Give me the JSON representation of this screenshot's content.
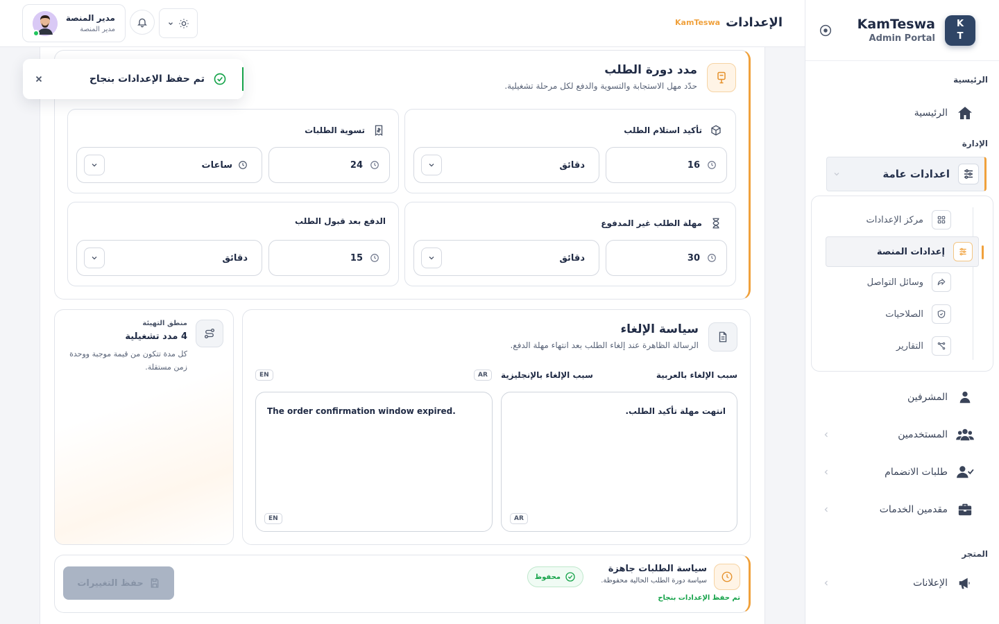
{
  "brand": {
    "initials_top": "K",
    "initials_bottom": "T",
    "name": "KamTeswa",
    "sub": "Admin Portal"
  },
  "sidebar": {
    "section_main": "الرئيسية",
    "home": "الرئيسية",
    "section_admin": "الإدارة",
    "general_settings": "اعدادات عامة",
    "submenu": [
      "مركز الإعدادات",
      "إعدادات المنصة",
      "وسائل التواصل",
      "الصلاحيات",
      "التقارير"
    ],
    "supervisors": "المشرفين",
    "users": "المستخدمين",
    "join_requests": "طلبات الانضمام",
    "providers": "مقدمين الخدمات",
    "section_store": "المتجر",
    "ads": "الإعلانات"
  },
  "topbar": {
    "title": "الإعدادات",
    "brand_badge": "KamTeswa"
  },
  "user": {
    "name": "مدير المنصة",
    "role": "مدير المنصة"
  },
  "lifecycle": {
    "title": "مدد دورة الطلب",
    "subtitle": "حدّد مهل الاستجابة والتسوية والدفع لكل مرحلة تشغيلية.",
    "confirm": {
      "label": "تأكيد استلام الطلب",
      "value": "16",
      "unit": "دقائق"
    },
    "settle": {
      "label": "تسوية الطلبات",
      "value": "24",
      "unit": "ساعات"
    },
    "unpaid": {
      "label": "مهلة الطلب غير المدفوع",
      "value": "30",
      "unit": "دقائق"
    },
    "payment": {
      "label": "الدفع بعد قبول الطلب",
      "value": "15",
      "unit": "دقائق"
    }
  },
  "cancel": {
    "title": "سياسة الإلغاء",
    "subtitle": "الرسالة الظاهرة عند إلغاء الطلب بعد انتهاء مهلة الدفع.",
    "ar_label": "سبب الإلغاء بالعربية",
    "en_label": "سبب الإلغاء بالإنجليزية",
    "ar_tag": "AR",
    "en_tag": "EN",
    "ar_value": "انتهت مهلة تأكيد الطلب.",
    "en_value": "The order confirmation window expired."
  },
  "logic": {
    "kicker": "منطق التهيئة",
    "value": "4 مدد تشغيلية",
    "desc": "كل مدة تتكون من قيمة موجبة ووحدة زمن مستقلة."
  },
  "footer": {
    "title": "سياسة الطلبات جاهزة",
    "subtitle": "سياسة دورة الطلب الحالية محفوظة.",
    "saved_ok": "تم حفظ الإعدادات بنجاح",
    "badge": "محفوظ",
    "save_button": "حفظ التغييرات"
  },
  "toast": {
    "message": "تم حفظ الإعدادات بنجاح"
  },
  "colors": {
    "accent": "#f0a13c",
    "success": "#16a34a",
    "brand": "#2f4566"
  }
}
